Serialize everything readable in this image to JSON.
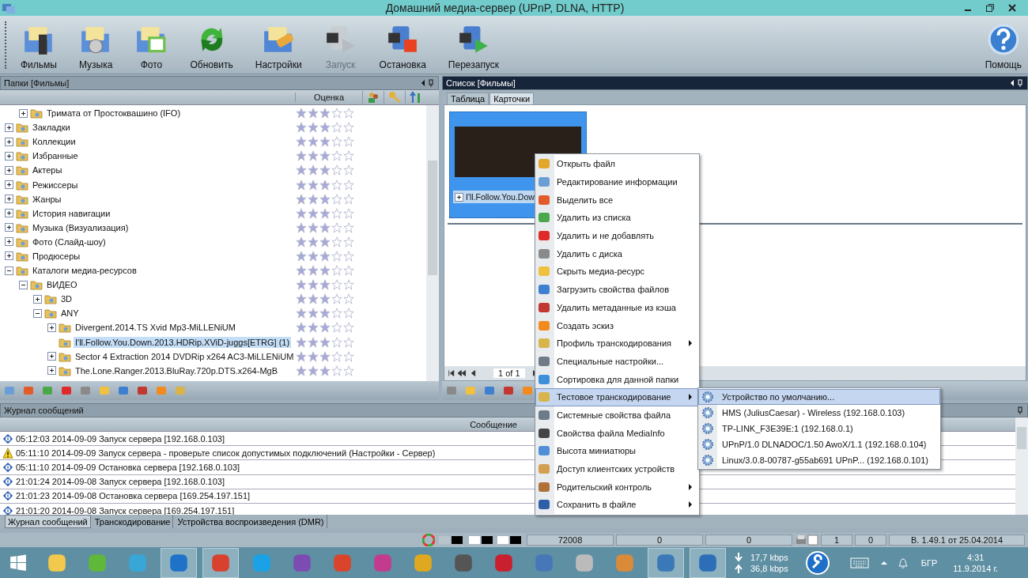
{
  "window": {
    "title": "Домашний медиа-сервер (UPnP, DLNA, HTTP)"
  },
  "toolbar": [
    {
      "kind": "movies",
      "label": "Фильмы",
      "disabled": false
    },
    {
      "kind": "music",
      "label": "Музыка",
      "disabled": false
    },
    {
      "kind": "photo",
      "label": "Фото",
      "disabled": false
    },
    {
      "kind": "refresh",
      "label": "Обновить",
      "disabled": false
    },
    {
      "kind": "settings",
      "label": "Настройки",
      "disabled": false
    },
    {
      "kind": "start",
      "label": "Запуск",
      "disabled": true
    },
    {
      "kind": "stop",
      "label": "Остановка",
      "disabled": false
    },
    {
      "kind": "restart",
      "label": "Перезапуск",
      "disabled": false
    }
  ],
  "help_button": {
    "label": "Помощь"
  },
  "folders_panel": {
    "title": "Папки [Фильмы]",
    "rating_column": "Оценка",
    "continued_items": [
      {
        "label": "Тримата от Простоквашино (IFO)",
        "expanded": false,
        "selected": false,
        "stars": 3
      }
    ],
    "items": [
      {
        "label": "Закладки",
        "expanded": false,
        "selected": false,
        "stars": 3
      },
      {
        "label": "Коллекции",
        "expanded": false,
        "selected": false,
        "stars": 3
      },
      {
        "label": "Избранные",
        "expanded": false,
        "selected": false,
        "stars": 3
      },
      {
        "label": "Актеры",
        "expanded": false,
        "selected": false,
        "stars": 3
      },
      {
        "label": "Режиссеры",
        "expanded": false,
        "selected": false,
        "stars": 3
      },
      {
        "label": "Жанры",
        "expanded": false,
        "selected": false,
        "stars": 3
      },
      {
        "label": "История навигации",
        "expanded": false,
        "selected": false,
        "stars": 3
      },
      {
        "label": "Музыка (Визуализация)",
        "expanded": false,
        "selected": false,
        "stars": 3
      },
      {
        "label": "Фото (Слайд-шоу)",
        "expanded": false,
        "selected": false,
        "stars": 3
      },
      {
        "label": "Продюсеры",
        "expanded": false,
        "selected": false,
        "stars": 3
      },
      {
        "label": "Каталоги медиа-ресурсов",
        "expanded": true,
        "selected": false,
        "stars": 3,
        "children": [
          {
            "label": "ВИДЕО",
            "expanded": true,
            "selected": false,
            "stars": 3,
            "children": [
              {
                "label": "3D",
                "expanded": false,
                "selected": false,
                "stars": 3
              },
              {
                "label": "ANY",
                "expanded": true,
                "selected": false,
                "stars": 3,
                "children": [
                  {
                    "label": "Divergent.2014.TS Xvid Mp3-MiLLENiUM",
                    "expanded": false,
                    "selected": false,
                    "stars": 3
                  },
                  {
                    "label": "I'll.Follow.You.Down.2013.HDRip.XViD-juggs[ETRG] (1)",
                    "selected": true,
                    "stars": 3
                  },
                  {
                    "label": "Sector 4 Extraction 2014 DVDRip x264 AC3-MiLLENiUM",
                    "expanded": false,
                    "selected": false,
                    "stars": 3
                  },
                  {
                    "label": "The.Lone.Ranger.2013.BluRay.720p.DTS.x264-MgB",
                    "expanded": false,
                    "selected": false,
                    "stars": 3
                  }
                ]
              }
            ]
          }
        ]
      }
    ]
  },
  "list_panel": {
    "title": "Список [Фильмы]",
    "tabs": [
      {
        "label": "Таблица",
        "selected": false
      },
      {
        "label": "Карточки",
        "selected": true
      }
    ],
    "card": {
      "label": "I'll.Follow.You.Dow"
    },
    "pager": "1 of 1"
  },
  "context_menu": [
    {
      "label": "Открыть файл",
      "submenu": false,
      "selected": false
    },
    {
      "label": "Редактирование информации",
      "submenu": false,
      "selected": false
    },
    {
      "label": "Выделить все",
      "submenu": false,
      "selected": false
    },
    {
      "label": "Удалить из списка",
      "submenu": false,
      "selected": false
    },
    {
      "label": "Удалить и не добавлять",
      "submenu": false,
      "selected": false
    },
    {
      "label": "Удалить с диска",
      "submenu": false,
      "selected": false
    },
    {
      "label": "Скрыть медиа-ресурс",
      "submenu": false,
      "selected": false
    },
    {
      "label": "Загрузить свойства файлов",
      "submenu": false,
      "selected": false
    },
    {
      "label": "Удалить метаданные из кэша",
      "submenu": false,
      "selected": false
    },
    {
      "label": "Создать эскиз",
      "submenu": false,
      "selected": false
    },
    {
      "label": "Профиль транскодирования",
      "submenu": true,
      "selected": false
    },
    {
      "label": "Специальные настройки...",
      "submenu": false,
      "selected": false
    },
    {
      "label": "Сортировка для данной папки",
      "submenu": false,
      "selected": false
    },
    {
      "label": "Тестовое транскодирование",
      "submenu": true,
      "selected": true
    },
    {
      "label": "Системные свойства файла",
      "submenu": false,
      "selected": false
    },
    {
      "label": "Свойства файла MediaInfo",
      "submenu": false,
      "selected": false
    },
    {
      "label": "Высота миниатюры",
      "submenu": false,
      "selected": false
    },
    {
      "label": "Доступ клиентских устройств",
      "submenu": false,
      "selected": false
    },
    {
      "label": "Родительский контроль",
      "submenu": true,
      "selected": false
    },
    {
      "label": "Сохранить в файле",
      "submenu": true,
      "selected": false
    }
  ],
  "submenu": [
    {
      "label": "Устройство по умолчанию...",
      "selected": true
    },
    {
      "label": "HMS (JuliusCaesar) - Wireless (192.168.0.103)",
      "selected": false
    },
    {
      "label": "TP-LINK_F3E39E:1 (192.168.0.1)",
      "selected": false
    },
    {
      "label": "UPnP/1.0 DLNADOC/1.50 AwoX/1.1 (192.168.0.104)",
      "selected": false
    },
    {
      "label": "Linux/3.0.8-00787-g55ab691 UPnP... (192.168.0.101)",
      "selected": false
    }
  ],
  "log_panel": {
    "title": "Журнал сообщений",
    "column": "Сообщение",
    "rows": [
      {
        "kind": "info",
        "text": "05:12:03 2014-09-09 Запуск сервера [192.168.0.103]"
      },
      {
        "kind": "warning",
        "text": "05:11:10 2014-09-09 Запуск сервера - проверьте список допустимых подключений (Настройки - Сервер)"
      },
      {
        "kind": "info",
        "text": "05:11:10 2014-09-09 Остановка сервера [192.168.0.103]"
      },
      {
        "kind": "info",
        "text": "21:01:24 2014-09-08 Запуск сервера [192.168.0.103]"
      },
      {
        "kind": "info",
        "text": "21:01:23 2014-09-08 Остановка сервера [169.254.197.151]"
      },
      {
        "kind": "info",
        "text": "21:01:20 2014-09-08 Запуск сервера [169.254.197.151]"
      }
    ],
    "tabs": [
      {
        "label": "Журнал сообщений",
        "selected": true
      },
      {
        "label": "Транскодирование",
        "selected": false
      },
      {
        "label": "Устройства воспроизведения (DMR)",
        "selected": false
      }
    ]
  },
  "status_bar": {
    "cells": [
      "72008",
      "0",
      "0"
    ],
    "counters": [
      "1",
      "0"
    ],
    "version": "В. 1.49.1 от 25.04.2014"
  },
  "taskbar": {
    "apps": [
      {
        "active": false
      },
      {
        "active": false
      },
      {
        "active": false
      },
      {
        "active": true
      },
      {
        "active": true
      },
      {
        "active": false
      },
      {
        "active": false
      },
      {
        "active": false
      },
      {
        "active": false
      },
      {
        "active": false
      },
      {
        "active": false
      },
      {
        "active": false
      },
      {
        "active": false
      },
      {
        "active": false
      },
      {
        "active": false
      },
      {
        "active": true
      },
      {
        "active": true
      }
    ],
    "download": "17,7 kbps",
    "upload": "36,8 kbps",
    "language": "БГР",
    "time": "4:31",
    "date": "11.9.2014 г."
  }
}
